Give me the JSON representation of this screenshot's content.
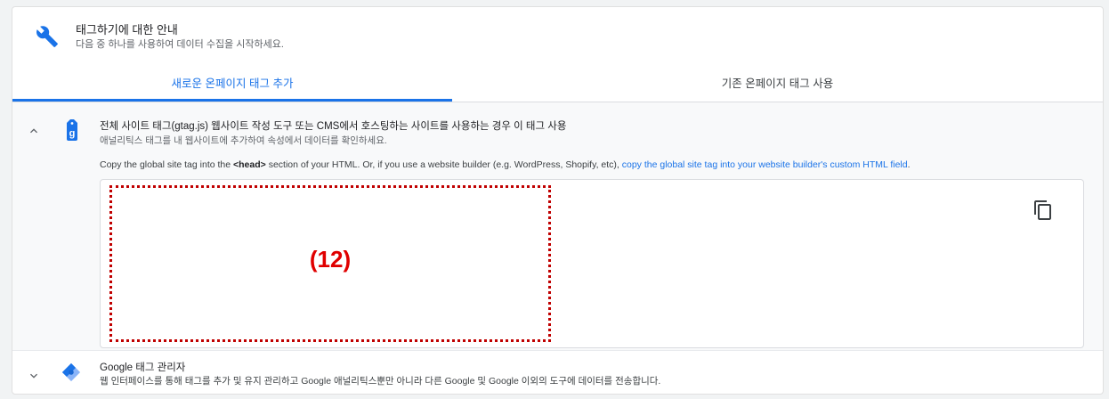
{
  "header": {
    "title": "태그하기에 대한 안내",
    "subtitle": "다음 중 하나를 사용하여 데이터 수집을 시작하세요."
  },
  "tabs": [
    {
      "label": "새로운 온페이지 태그 추가",
      "active": true
    },
    {
      "label": "기존 온페이지 태그 사용",
      "active": false
    }
  ],
  "gtag_section": {
    "title": "전체 사이트 태그(gtag.js) 웹사이트 작성 도구 또는 CMS에서 호스팅하는 사이트를 사용하는 경우 이 태그 사용",
    "subtitle": "애널리틱스 태그를 내 웹사이트에 추가하여 속성에서 데이터를 확인하세요.",
    "instruction_prefix": "Copy the global site tag into the ",
    "instruction_bold": "<head>",
    "instruction_middle": " section of your HTML. Or, if you use a website builder (e.g. WordPress, Shopify, etc), ",
    "instruction_link": "copy the global site tag into your website builder's custom HTML field",
    "instruction_suffix": ".",
    "redaction_label": "(12)"
  },
  "gtm_section": {
    "title": "Google 태그 관리자",
    "subtitle": "웹 인터페이스를 통해 태그를 추가 및 유지 관리하고 Google 애널리틱스뿐만 아니라 다른 Google 및 Google 이외의 도구에 데이터를 전송합니다."
  },
  "icons": {
    "header": "wrench-icon",
    "expand_up": "chevron-up-icon",
    "gtag": "gtag-icon",
    "copy": "copy-icon",
    "expand_down": "chevron-down-icon",
    "gtm": "tag-manager-icon"
  },
  "colors": {
    "accent": "#1a73e8",
    "redaction": "#e00000"
  }
}
